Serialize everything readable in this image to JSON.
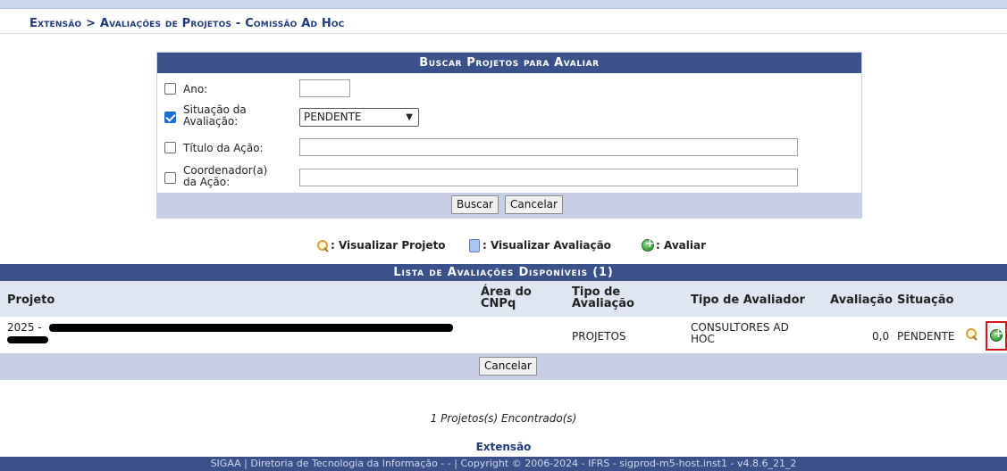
{
  "breadcrumb": "Extensão > Avaliações de Projetos - Comissão Ad Hoc",
  "search_form": {
    "caption": "Buscar Projetos para Avaliar",
    "ano_label": "Ano:",
    "ano_value": "",
    "situacao_label_line1": "Situação da",
    "situacao_label_line2": "Avaliação:",
    "situacao_checked": true,
    "situacao_value": "PENDENTE",
    "titulo_label": "Título da Ação:",
    "titulo_value": "",
    "coord_label_line1": "Coordenador(a)",
    "coord_label_line2": "da Ação:",
    "coord_value": "",
    "buscar_label": "Buscar",
    "cancelar_label": "Cancelar"
  },
  "legend": {
    "visualizar_projeto": ": Visualizar Projeto",
    "visualizar_avaliacao": ": Visualizar Avaliação",
    "avaliar": ": Avaliar"
  },
  "list": {
    "caption": "Lista de Avaliações Disponíveis (1)",
    "headers": {
      "projeto": "Projeto",
      "area_line1": "Área do",
      "area_line2": "CNPq",
      "tipo_aval_line1": "Tipo de",
      "tipo_aval_line2": "Avaliação",
      "tipo_avaliador": "Tipo de Avaliador",
      "avaliacao": "Avaliação",
      "situacao": "Situação"
    },
    "row": {
      "projeto_prefix": "2025 -",
      "tipo_avaliacao": "PROJETOS",
      "tipo_avaliador_line1": "CONSULTORES AD",
      "tipo_avaliador_line2": "HOC",
      "avaliacao": "0,0",
      "situacao": "PENDENTE"
    },
    "cancelar_label": "Cancelar"
  },
  "found_text": "1 Projetos(s) Encontrado(s)",
  "extensao_link": "Extensão",
  "footer": "SIGAA | Diretoria de Tecnologia da Informação - - | Copyright © 2006-2024 - IFRS - sigprod-m5-host.inst1 - v4.8.6_21_2",
  "colors": {
    "header_blue": "#3a5189",
    "light_blue": "#c7cfe4",
    "highlight_red": "#d6141b"
  },
  "icons": [
    "magnifier-icon",
    "document-icon",
    "green-plus-icon"
  ]
}
